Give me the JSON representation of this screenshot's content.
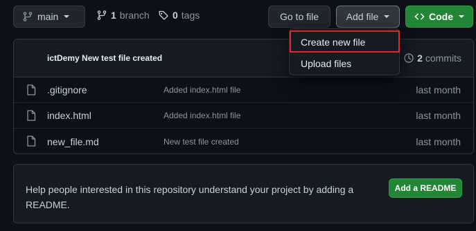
{
  "toolbar": {
    "branch_label": "main",
    "branch_count": "1",
    "branch_word": "branch",
    "tag_count": "0",
    "tag_word": "tags",
    "goto_file": "Go to file",
    "add_file": "Add file",
    "code": "Code"
  },
  "add_file_menu": {
    "items": [
      {
        "label": "Create new file",
        "highlighted": true
      },
      {
        "label": "Upload files"
      }
    ]
  },
  "latest_commit": {
    "message": "ictDemy New test file created",
    "commit_count": "2",
    "commit_word": "commits"
  },
  "files": [
    {
      "name": ".gitignore",
      "commit": "Added index.html file",
      "time": "last month"
    },
    {
      "name": "index.html",
      "commit": "Added index.html file",
      "time": "last month"
    },
    {
      "name": "new_file.md",
      "commit": "New test file created",
      "time": "last month"
    }
  ],
  "readme_banner": {
    "text": "Help people interested in this repository understand your project by adding a README.",
    "button": "Add a README"
  },
  "colors": {
    "background": "#0d1117",
    "primary_green": "#238636",
    "highlight_red": "#e0272a"
  }
}
